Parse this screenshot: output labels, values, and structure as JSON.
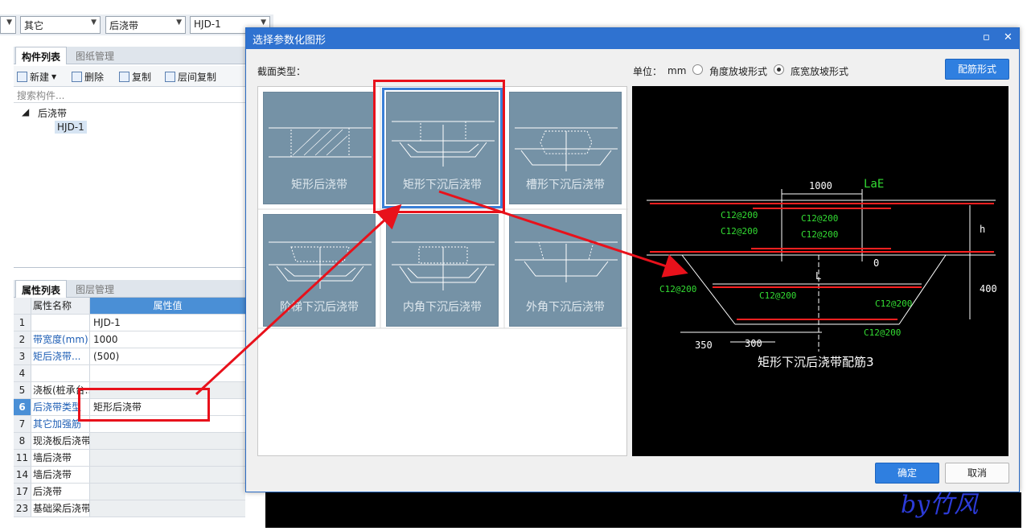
{
  "toolbar_combos": [
    "其它",
    "后浇带",
    "HJD-1"
  ],
  "component_panel": {
    "tabs": [
      "构件列表",
      "图纸管理"
    ],
    "buttons": [
      "新建",
      "删除",
      "复制",
      "层间复制"
    ],
    "search_placeholder": "搜索构件...",
    "tree_root": "后浇带",
    "tree_child": "HJD-1"
  },
  "property_panel": {
    "tabs": [
      "属性列表",
      "图层管理"
    ],
    "header_name": "属性名称",
    "header_value": "属性值",
    "rows": [
      {
        "num": "1",
        "name": "",
        "value": "HJD-1"
      },
      {
        "num": "2",
        "name": "带宽度(mm)",
        "value": "1000"
      },
      {
        "num": "3",
        "name": "矩后浇带...",
        "value": "(500)"
      },
      {
        "num": "4",
        "name": "",
        "value": ""
      },
      {
        "num": "5",
        "name": "浇板(桩承台...",
        "value": ""
      },
      {
        "num": "6",
        "name": "后浇带类型",
        "value": "矩形后浇带"
      },
      {
        "num": "7",
        "name": "其它加强筋",
        "value": ""
      },
      {
        "num": "8",
        "name": "现浇板后浇带",
        "value": ""
      },
      {
        "num": "11",
        "name": "墙后浇带",
        "value": ""
      },
      {
        "num": "14",
        "name": "墙后浇带",
        "value": ""
      },
      {
        "num": "17",
        "name": "后浇带",
        "value": ""
      },
      {
        "num": "23",
        "name": "基础梁后浇带",
        "value": ""
      }
    ]
  },
  "dialog": {
    "title": "选择参数化图形",
    "section_type_label": "截面类型：",
    "unit_label": "单位：",
    "unit_value": "mm",
    "radio_angle": "角度放坡形式",
    "radio_width": "底宽放坡形式",
    "rebar_button": "配筋形式",
    "ok": "确定",
    "cancel": "取消",
    "shapes": [
      "矩形后浇带",
      "矩形下沉后浇带",
      "槽形下沉后浇带",
      "阶梯下沉后浇带",
      "内角下沉后浇带",
      "外角下沉后浇带"
    ],
    "preview": {
      "caption": "矩形下沉后浇带配筋3",
      "labels": {
        "width": "1000",
        "lae": "LaE",
        "h": "h",
        "zero": "0",
        "l": "L",
        "depth": "400",
        "d350": "350",
        "d300": "300",
        "c1": "C12@200"
      }
    }
  },
  "signature": "by竹风",
  "colors": {
    "annotation": "#e8111b",
    "accent": "#2f72d0",
    "tile": "#7592a6"
  }
}
